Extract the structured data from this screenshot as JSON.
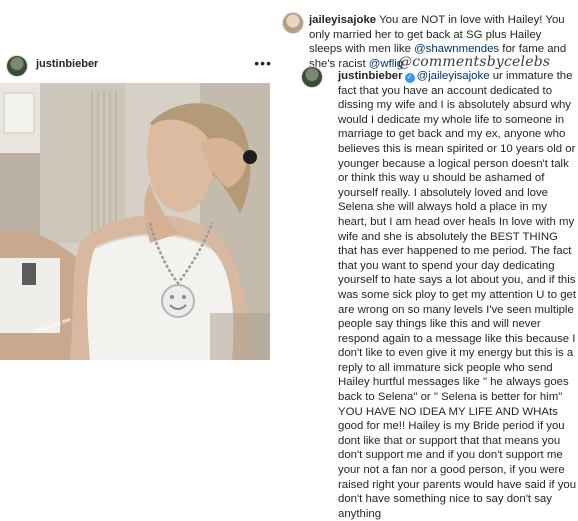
{
  "post": {
    "username": "justinbieber",
    "more_icon": "more-horizontal-icon",
    "more_glyph": "•••",
    "photo_caption": "That's my tee"
  },
  "comments": [
    {
      "username": "jaileyisajoke",
      "text_before": "You are NOT in love with Hailey! You only married her to get back at SG plus Hailey sleeps with men like ",
      "mention1": "@shawnmendes",
      "text_middle": " for fame and she's racist ",
      "mention2": "@wflig"
    },
    {
      "username": "justinbieber",
      "verified": true,
      "verified_glyph": "✓",
      "mention": "@jaileyisajoke",
      "text": " ur immature the fact that you have an account dedicated to dissing my wife and I is absolutely absurd why would I dedicate my whole life to someone in marriage to get back and my ex, anyone who believes this is mean spirited or 10 years old or younger because a logical person doesn't talk or think this way u should be ashamed of yourself really.  I absolutely loved and love Selena she will always hold a place in my heart, but I am head over heals In love with my wife and she is absolutely the BEST THING that has ever happened to me period. The fact that you want to spend your day dedicating yourself to hate says a lot about you, and if this was some sick ploy to get my attention U to get are wrong on so many levels I've seen multiple people say things like this and will never respond again to a message like this because I don't like to even give it my energy but this is a reply to all immature sick people who send Hailey hurtful messages like \" he always goes back to Selena\" or \" Selena is better for him\" YOU HAVE NO IDEA MY LIFE AND WHAts good for me!! Hailey is my Bride period if you dont like that or support that that means you don't support me and if you don't support me your not a fan nor a good person, if you were raised right your parents would have said if you don't have something nice to say don't say anything"
    }
  ],
  "watermark": "@commentsbycelebs"
}
